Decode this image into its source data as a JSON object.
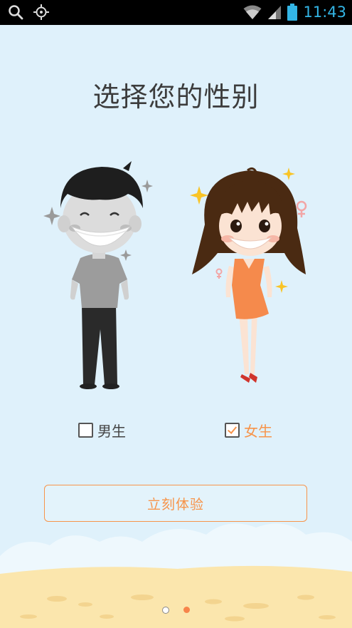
{
  "status_bar": {
    "time": "11:43"
  },
  "title": "选择您的性别",
  "options": {
    "male": {
      "label": "男生",
      "checked": false
    },
    "female": {
      "label": "女生",
      "checked": true
    }
  },
  "cta": {
    "label": "立刻体验"
  },
  "pagination": {
    "total": 2,
    "active": 2
  },
  "colors": {
    "accent": "#f7944a",
    "background": "#dff1fb",
    "status_icon": "#33b5e5"
  }
}
